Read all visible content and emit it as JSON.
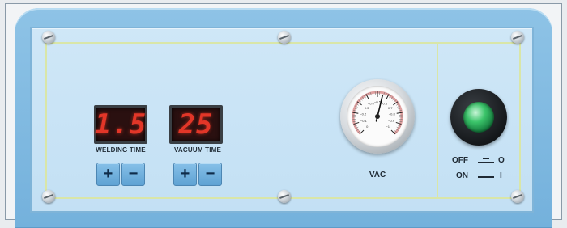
{
  "controls": {
    "welding_time": {
      "display_value": "1.5",
      "label": "WELDING TIME",
      "plus": "+",
      "minus": "−"
    },
    "vacuum_time": {
      "display_value": "25",
      "label": "VACUUM TIME",
      "plus": "+",
      "minus": "−"
    }
  },
  "gauge": {
    "label": "VAC",
    "scale_labels": [
      "0",
      "−0.1",
      "−0.2",
      "−0.3",
      "−0.4",
      "−0.5",
      "−0.6",
      "−0.7",
      "−0.8",
      "−0.9",
      "−1"
    ],
    "needle_fraction": 0.55
  },
  "switch": {
    "off_label": "OFF",
    "off_state": "O",
    "on_label": "ON",
    "on_state": "I",
    "lens_color": "#3bc46a"
  },
  "colors": {
    "panel": "#c8e3f5",
    "housing": "#7fb8df",
    "display_digits": "#e23628"
  }
}
